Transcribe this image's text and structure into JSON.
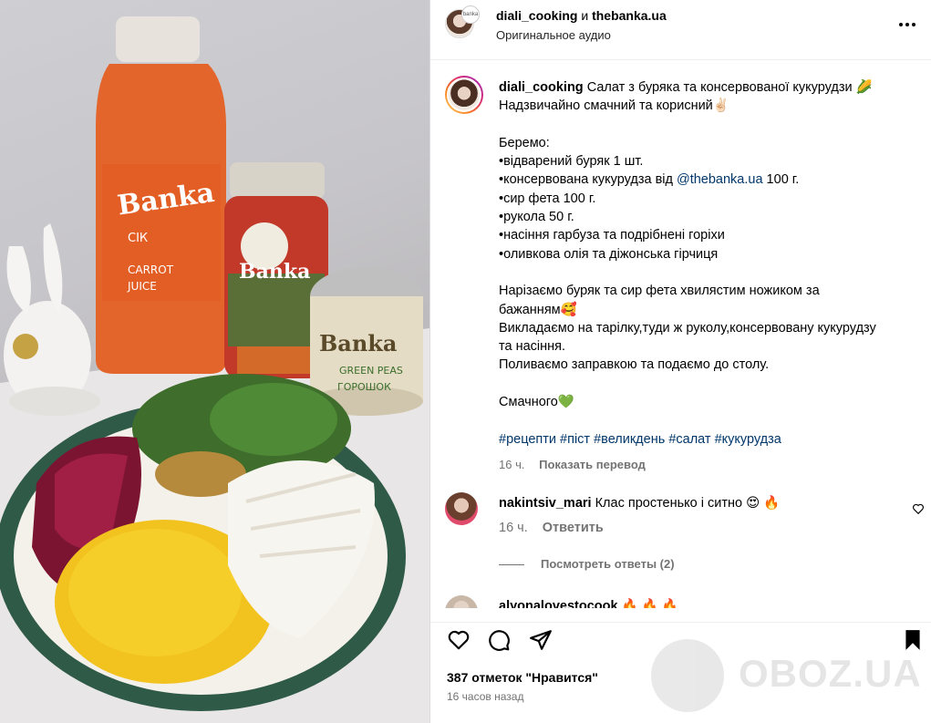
{
  "header": {
    "author": "diali_cooking",
    "and_word": "и",
    "collaborator": "thebanka.ua",
    "audio": "Оригинальное аудио",
    "collab_avatar_text": "banka"
  },
  "caption": {
    "username": "diali_cooking",
    "lines": [
      "Салат з буряка та консервованої кукурудзи 🌽",
      "Надзвичайно смачний та корисний✌🏻",
      "",
      "Беремо:",
      "•відварений буряк 1 шт.",
      "•консервована кукурудза від ",
      "•сир фета 100 г.",
      "•рукола 50 г.",
      "•насіння гарбуза та подрібнені горіхи",
      "•оливкова олія та діжонська гірчиця",
      "",
      "Нарізаємо буряк та сир фета хвилястим ножиком за",
      "бажанням🥰",
      "Викладаємо на тарілку,туди ж руколу,консервовану кукурудзу",
      "та насіння.",
      "Поливаємо заправкою та подаємо до столу.",
      "",
      "Смачного💚",
      ""
    ],
    "mention": "@thebanka.ua",
    "mention_suffix": " 100 г.",
    "hashtags": [
      "#рецепти",
      "#піст",
      "#великдень",
      "#салат",
      "#кукурудза"
    ],
    "time": "16 ч.",
    "translate": "Показать перевод"
  },
  "comments": [
    {
      "username": "nakintsiv_mari",
      "text": "Клас простенько і ситно 😍 🔥",
      "time": "16 ч.",
      "reply": "Ответить",
      "view_replies": "Посмотреть ответы (2)"
    },
    {
      "username": "alyonalovestocook",
      "text": "🔥 🔥 🔥"
    }
  ],
  "footer": {
    "likes": "387 отметок \"Нравится\"",
    "time": "16 часов назад",
    "watermark": "OBOZ.UA"
  },
  "colors": {
    "link": "#00376b",
    "muted": "#737373",
    "border": "#dbdbdb"
  }
}
